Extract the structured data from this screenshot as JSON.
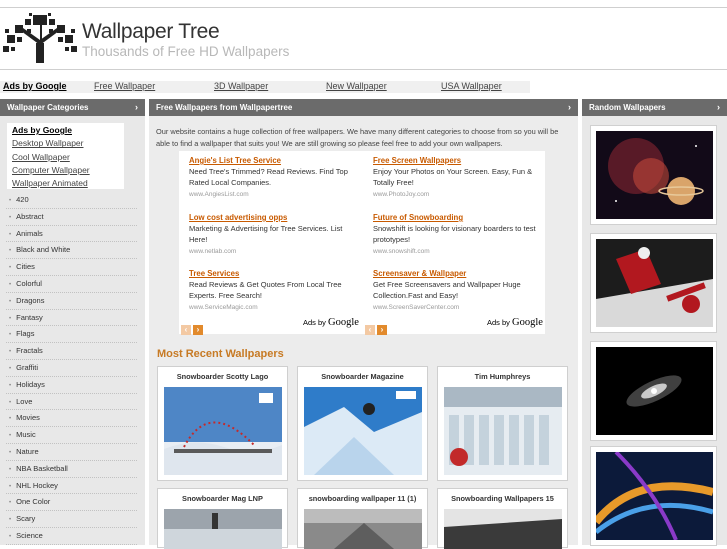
{
  "header": {
    "title": "Wallpaper Tree",
    "subtitle": "Thousands of Free HD Wallpapers"
  },
  "linkbar": {
    "ads_label": "Ads by Google",
    "links": [
      "Free Wallpaper",
      "3D Wallpaper",
      "New Wallpaper",
      "USA Wallpaper"
    ]
  },
  "left": {
    "heading": "Wallpaper Categories",
    "ads_title": "Ads by Google",
    "ad_links": [
      "Desktop Wallpaper",
      "Cool Wallpaper",
      "Computer Wallpaper",
      "Wallpaper Animated"
    ],
    "categories": [
      "420",
      "Abstract",
      "Animals",
      "Black and White",
      "Cities",
      "Colorful",
      "Dragons",
      "Fantasy",
      "Flags",
      "Fractals",
      "Graffiti",
      "Holidays",
      "Love",
      "Movies",
      "Music",
      "Nature",
      "NBA Basketball",
      "NHL Hockey",
      "One Color",
      "Scary",
      "Science"
    ]
  },
  "middle": {
    "heading": "Free Wallpapers from Wallpapertree",
    "intro": "Our website contains a huge collection of free wallpapers. We have many different categories to choose from so you will be able to find a wallpaper that suits you! We are still growing so please feel free to add your own wallpapers.",
    "ads": [
      {
        "title": "Angie's List Tree Service",
        "text": "Need Tree's Trimmed? Read Reviews. Find Top Rated Local Companies.",
        "url": "www.AngiesList.com"
      },
      {
        "title": "Free Screen Wallpapers",
        "text": "Enjoy Your Photos on Your Screen. Easy, Fun & Totally Free!",
        "url": "www.PhotoJoy.com"
      },
      {
        "title": "Low cost advertising opps",
        "text": "Marketing & Advertising for Tree Services. List Here!",
        "url": "www.netlab.com"
      },
      {
        "title": "Future of Snowboarding",
        "text": "Snowshift is looking for visionary boarders to test prototypes!",
        "url": "www.snowshift.com"
      },
      {
        "title": "Tree Services",
        "text": "Read Reviews & Get Quotes From Local Tree Experts. Free Search!",
        "url": "www.ServiceMagic.com"
      },
      {
        "title": "Screensaver & Wallpaper",
        "text": "Get Free Screensavers and Wallpaper Huge Collection.Fast and Easy!",
        "url": "www.ScreenSaverCenter.com"
      }
    ],
    "ads_by": "Ads by",
    "google": "Google",
    "recent_title": "Most Recent Wallpapers",
    "wallpapers": [
      "Snowboarder Scotty Lago",
      "Snowboarder Magazine",
      "Tim Humphreys",
      "Snowboarder Mag LNP",
      "snowboarding wallpaper 11 (1)",
      "Snowboarding Wallpapers 15"
    ]
  },
  "right": {
    "heading": "Random Wallpapers"
  },
  "icons": {
    "chevron": "›",
    "prev": "‹",
    "next": "›"
  }
}
